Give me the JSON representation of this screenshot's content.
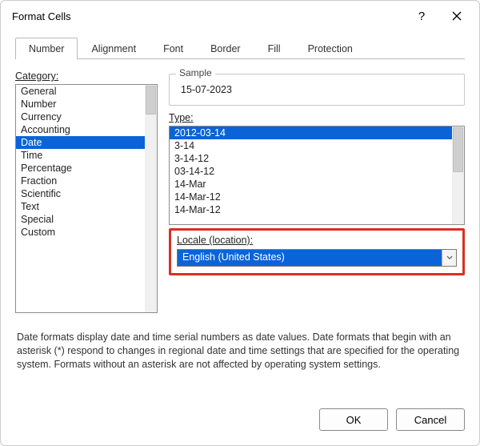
{
  "title": "Format Cells",
  "tabs": [
    "Number",
    "Alignment",
    "Font",
    "Border",
    "Fill",
    "Protection"
  ],
  "activeTab": 0,
  "categoryLabel": "Category:",
  "categories": [
    "General",
    "Number",
    "Currency",
    "Accounting",
    "Date",
    "Time",
    "Percentage",
    "Fraction",
    "Scientific",
    "Text",
    "Special",
    "Custom"
  ],
  "selectedCategory": "Date",
  "sampleLabel": "Sample",
  "sampleValue": "15-07-2023",
  "typeLabel": "Type:",
  "types": [
    "2012-03-14",
    "3-14",
    "3-14-12",
    "03-14-12",
    "14-Mar",
    "14-Mar-12",
    "14-Mar-12"
  ],
  "selectedType": "2012-03-14",
  "localeLabel": "Locale (location):",
  "localeValue": "English (United States)",
  "description": "Date formats display date and time serial numbers as date values.  Date formats that begin with an asterisk (*) respond to changes in regional date and time settings that are specified for the operating system.  Formats without an asterisk are not affected by operating system settings.",
  "buttons": {
    "ok": "OK",
    "cancel": "Cancel"
  }
}
